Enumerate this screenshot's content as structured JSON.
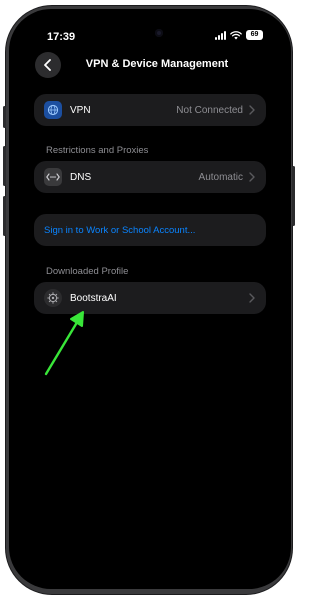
{
  "status_bar": {
    "time": "17:39",
    "battery": "69"
  },
  "nav": {
    "title": "VPN & Device Management"
  },
  "vpn": {
    "label": "VPN",
    "value": "Not Connected"
  },
  "restrictions": {
    "header": "Restrictions and Proxies",
    "dns": {
      "label": "DNS",
      "value": "Automatic"
    }
  },
  "sign_in": {
    "label": "Sign in to Work or School Account..."
  },
  "downloaded": {
    "header": "Downloaded Profile",
    "profile": {
      "label": "BootstraAI"
    }
  },
  "colors": {
    "accent": "#0a84ff",
    "row_background": "#1c1c1e",
    "secondary_text": "#8e8e93",
    "annotation_arrow": "#39e639"
  },
  "icons": [
    "back-chevron-icon",
    "globe-icon",
    "dns-icon",
    "gear-icon",
    "chevron-right-icon",
    "signal-icon",
    "wifi-icon"
  ]
}
